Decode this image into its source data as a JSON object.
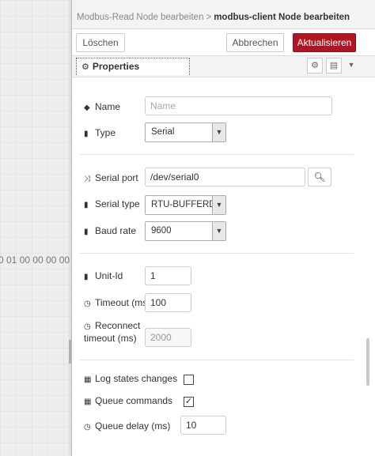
{
  "canvas": {
    "node_bytes": "0 01 00 00 00 00"
  },
  "header": {
    "breadcrumb_prev": "Modbus-Read Node bearbeiten",
    "breadcrumb_sep": ">",
    "breadcrumb_current": "modbus-client Node bearbeiten"
  },
  "toolbar": {
    "delete_label": "Löschen",
    "cancel_label": "Abbrechen",
    "update_label": "Aktualisieren"
  },
  "tabs": {
    "properties_label": "Properties"
  },
  "form": {
    "name": {
      "label": "Name",
      "value": "",
      "placeholder": "Name"
    },
    "type": {
      "label": "Type",
      "selected": "Serial"
    },
    "serial_port": {
      "label": "Serial port",
      "value": "/dev/serial0"
    },
    "serial_type": {
      "label": "Serial type",
      "selected": "RTU-BUFFERD"
    },
    "baud_rate": {
      "label": "Baud rate",
      "selected": "9600"
    },
    "unit_id": {
      "label": "Unit-Id",
      "value": "1"
    },
    "timeout": {
      "label": "Timeout (ms)",
      "value": "100"
    },
    "reconnect_timeout": {
      "label_line1": "Reconnect",
      "label_line2": "timeout (ms)",
      "value": "2000"
    },
    "log_states": {
      "label": "Log states changes",
      "checked": false
    },
    "queue_commands": {
      "label": "Queue commands",
      "checked": true
    },
    "queue_delay": {
      "label": "Queue delay (ms)",
      "value": "10"
    }
  },
  "colors": {
    "primary_button": "#ad1625",
    "canvas_bg": "#eeeeee"
  }
}
